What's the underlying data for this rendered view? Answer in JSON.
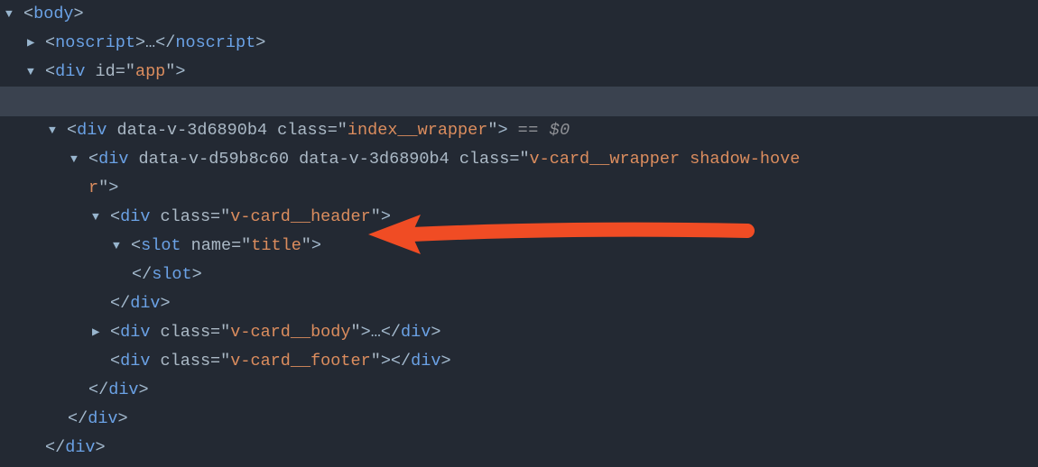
{
  "lines": {
    "body_open": {
      "tag": "body"
    },
    "noscript": {
      "tag": "noscript",
      "ellipsis": "…"
    },
    "div_app": {
      "tag": "div",
      "attr1_name": "id",
      "attr1_val": "app"
    },
    "div_index": {
      "tag": "div",
      "attr1_name": "data-v-3d6890b4",
      "attr2_name": "class",
      "attr2_val": "index__wrapper",
      "selected": "== $0"
    },
    "div_wrapper_a": {
      "tag": "div",
      "attr1_name": "data-v-d59b8c60",
      "attr2_name": "data-v-3d6890b4",
      "attr3_name": "class",
      "attr3_val": "v-card__wrapper shadow-hove"
    },
    "div_wrapper_b": {
      "cont": "r"
    },
    "div_header": {
      "tag": "div",
      "attr1_name": "class",
      "attr1_val": "v-card__header"
    },
    "slot_open": {
      "tag": "slot",
      "attr1_name": "name",
      "attr1_val": "title"
    },
    "slot_close": {
      "tag": "slot"
    },
    "div_header_close": {
      "tag": "div"
    },
    "div_body": {
      "tag": "div",
      "attr1_name": "class",
      "attr1_val": "v-card__body",
      "ellipsis": "…"
    },
    "div_footer": {
      "tag": "div",
      "attr1_name": "class",
      "attr1_val": "v-card__footer"
    },
    "div_close_1": {
      "tag": "div"
    },
    "div_close_2": {
      "tag": "div"
    },
    "div_close_3": {
      "tag": "div"
    }
  },
  "colors": {
    "bg": "#232933",
    "highlight": "#3a424f",
    "tag": "#6ba2e6",
    "attr": "#abb9c6",
    "value": "#dc8d5e",
    "annotation": "#f04c24"
  }
}
